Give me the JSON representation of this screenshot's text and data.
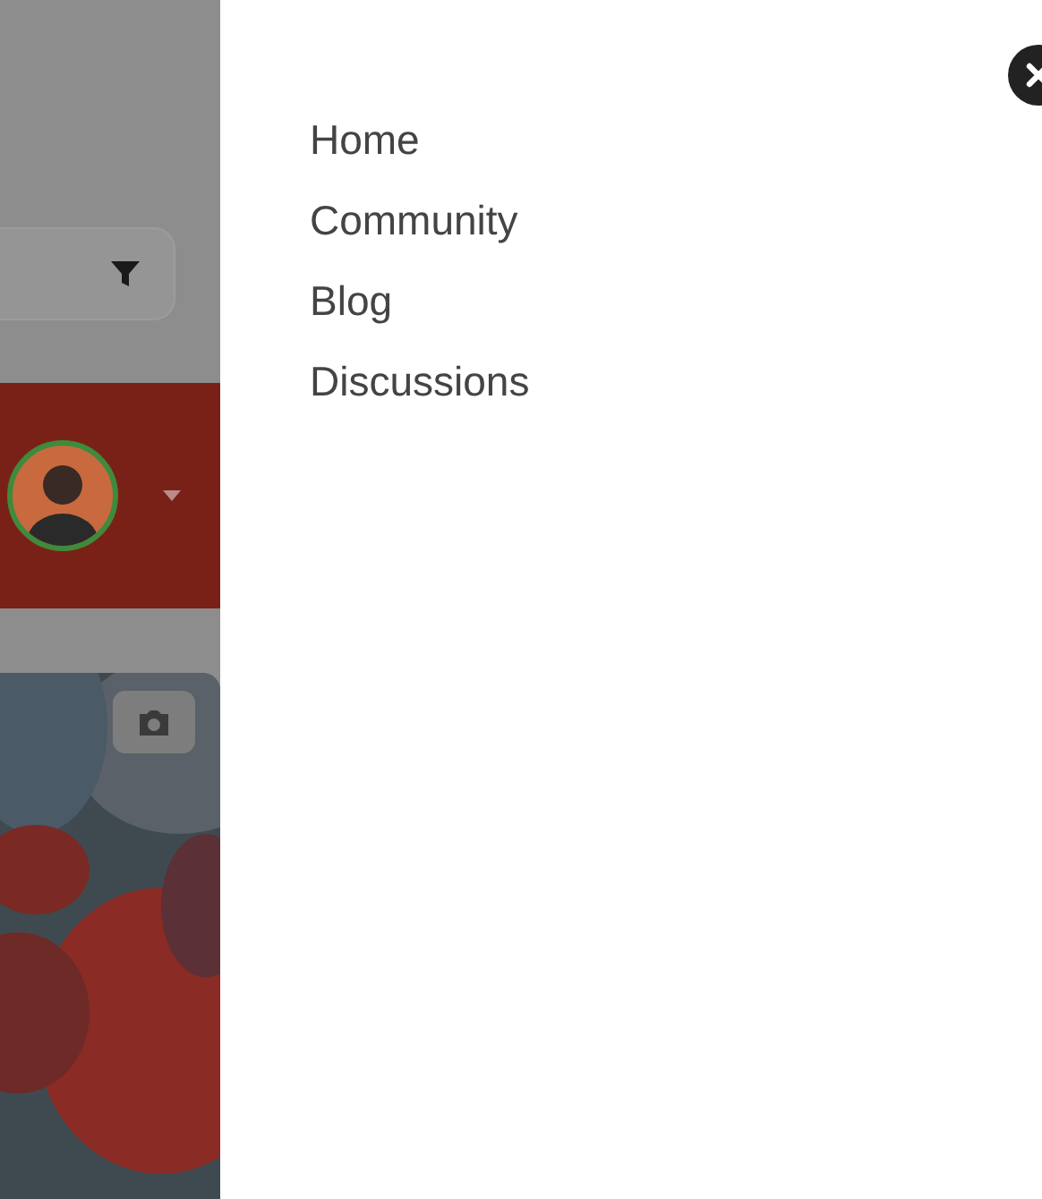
{
  "drawer": {
    "links": [
      {
        "label": "Home"
      },
      {
        "label": "Community"
      },
      {
        "label": "Blog"
      },
      {
        "label": "Discussions"
      }
    ]
  }
}
